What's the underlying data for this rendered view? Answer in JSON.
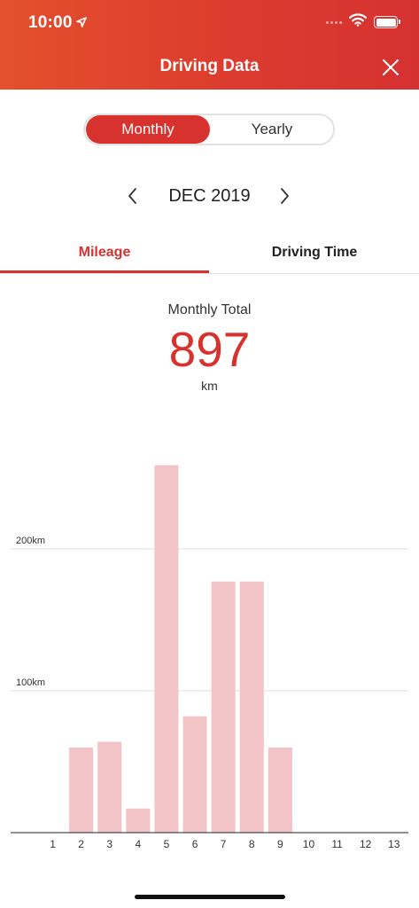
{
  "status_bar": {
    "time": "10:00"
  },
  "header": {
    "title": "Driving Data"
  },
  "segment": {
    "monthly": "Monthly",
    "yearly": "Yearly",
    "selected": "Monthly"
  },
  "month_nav": {
    "label": "DEC 2019"
  },
  "tabs": {
    "mileage": "Mileage",
    "driving_time": "Driving Time",
    "selected": "Mileage"
  },
  "summary": {
    "label": "Monthly Total",
    "value": "897",
    "unit": "km"
  },
  "colors": {
    "accent": "#d8322f",
    "bar": "#f2c3c7",
    "header_start": "#e4502c",
    "header_end": "#d63131"
  },
  "icons": {
    "location": "location-arrow-icon",
    "wifi": "wifi-icon",
    "battery": "battery-icon",
    "close": "close-icon",
    "prev": "chevron-left-icon",
    "next": "chevron-right-icon"
  },
  "chart_data": {
    "type": "bar",
    "categories": [
      "1",
      "2",
      "3",
      "4",
      "5",
      "6",
      "7",
      "8",
      "9",
      "10",
      "11",
      "12",
      "13"
    ],
    "values": [
      0,
      60,
      64,
      17,
      259,
      82,
      177,
      177,
      60,
      0,
      0,
      0,
      0
    ],
    "y_ticks": [
      {
        "value": 100,
        "label": "100km"
      },
      {
        "value": 200,
        "label": "200km"
      }
    ],
    "ylim": [
      0,
      300
    ],
    "grid": true
  }
}
